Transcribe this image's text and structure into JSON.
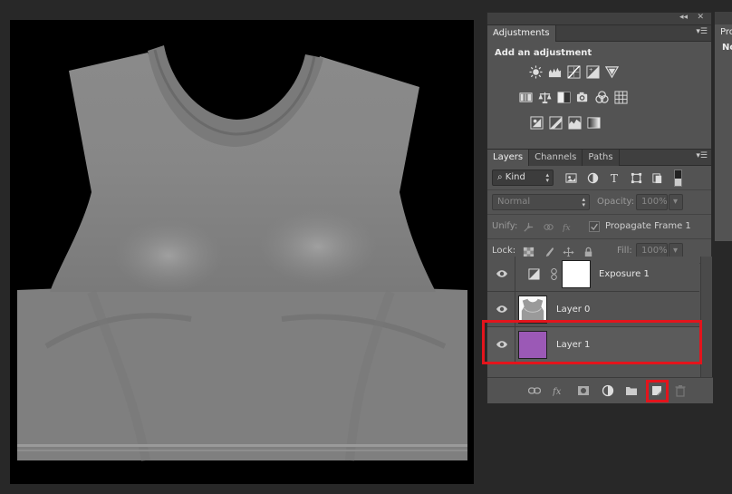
{
  "adjustments": {
    "tab_label": "Adjustments",
    "title": "Add an adjustment",
    "row1": [
      "brightness-contrast-icon",
      "levels-icon",
      "curves-icon",
      "exposure-icon",
      "vibrance-icon"
    ],
    "row2": [
      "hue-saturation-icon",
      "color-balance-icon",
      "black-white-icon",
      "photo-filter-icon",
      "channel-mixer-icon",
      "color-lookup-icon"
    ],
    "row3": [
      "invert-icon",
      "posterize-icon",
      "threshold-icon",
      "gradient-map-icon"
    ]
  },
  "layers_panel": {
    "tabs": [
      "Layers",
      "Channels",
      "Paths"
    ],
    "filter_kind": "Kind",
    "blend_mode": "Normal",
    "opacity_label": "Opacity:",
    "opacity_value": "100%",
    "unify_label": "Unify:",
    "propagate_label": "Propagate Frame 1",
    "lock_label": "Lock:",
    "fill_label": "Fill:",
    "fill_value": "100%",
    "layers": [
      {
        "name": "Exposure 1",
        "type": "adjustment",
        "visible": true
      },
      {
        "name": "Layer 0",
        "type": "image",
        "visible": true
      },
      {
        "name": "Layer 1",
        "type": "fill",
        "color": "#9b59b6",
        "visible": true,
        "highlighted": true
      }
    ]
  },
  "side_panel": {
    "tab_label": "Pro",
    "text": "No"
  },
  "colors": {
    "highlight": "#e3141c",
    "layer1_fill": "#9b59b6",
    "panel_bg": "#535353"
  }
}
